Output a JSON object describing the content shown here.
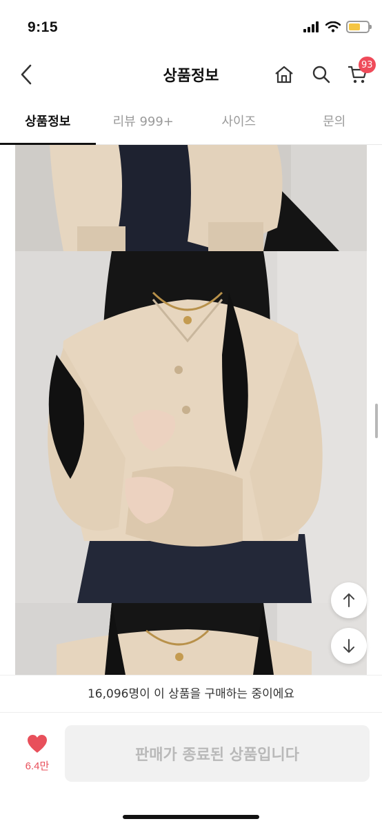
{
  "status": {
    "time": "9:15",
    "icons": [
      "signal-icon",
      "wifi-icon",
      "battery-icon"
    ]
  },
  "nav": {
    "title": "상품정보",
    "cart_badge": "93",
    "icons": [
      "chevron-left-icon",
      "home-icon",
      "search-icon",
      "cart-icon"
    ]
  },
  "tabs": [
    {
      "label": "상품정보"
    },
    {
      "label": "리뷰 999+"
    },
    {
      "label": "사이즈"
    },
    {
      "label": "문의"
    }
  ],
  "content": {
    "buyers_text": "16,096명이 이 상품을 구매하는 중이에요"
  },
  "bottom": {
    "like_count": "6.4만",
    "purchase_label": "판매가 종료된 상품입니다"
  },
  "colors": {
    "accent": "#ef4b5a",
    "like": "#e8505b",
    "disabled_bg": "#f1f1f1",
    "disabled_text": "#b9b9b9",
    "battery": "#f5c542"
  }
}
